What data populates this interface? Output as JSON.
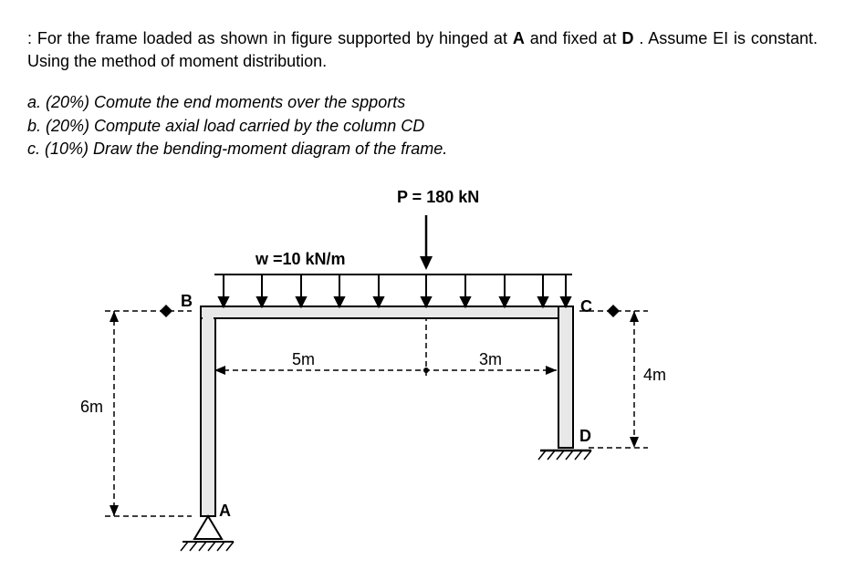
{
  "problem": {
    "intro_prefix": ": For the frame loaded as shown in figure supported by hinged at ",
    "intro_a": "A",
    "intro_mid": " and fixed at ",
    "intro_d": "D",
    "intro_end": ". Assume EI is constant. Using the method of moment distribution."
  },
  "tasks": {
    "a": "a. (20%) Comute the end moments over the spports",
    "b": "b. (20%) Compute axial load carried by the column CD",
    "c": "c. (10%) Draw the bending-moment diagram of the frame."
  },
  "diagram": {
    "point_load": "P = 180 kN",
    "dist_load": "w =10 kN/m",
    "node_a": "A",
    "node_b": "B",
    "node_c": "C",
    "node_d": "D",
    "dim_5m": "5m",
    "dim_3m": "3m",
    "dim_6m": "6m",
    "dim_4m": "4m"
  }
}
